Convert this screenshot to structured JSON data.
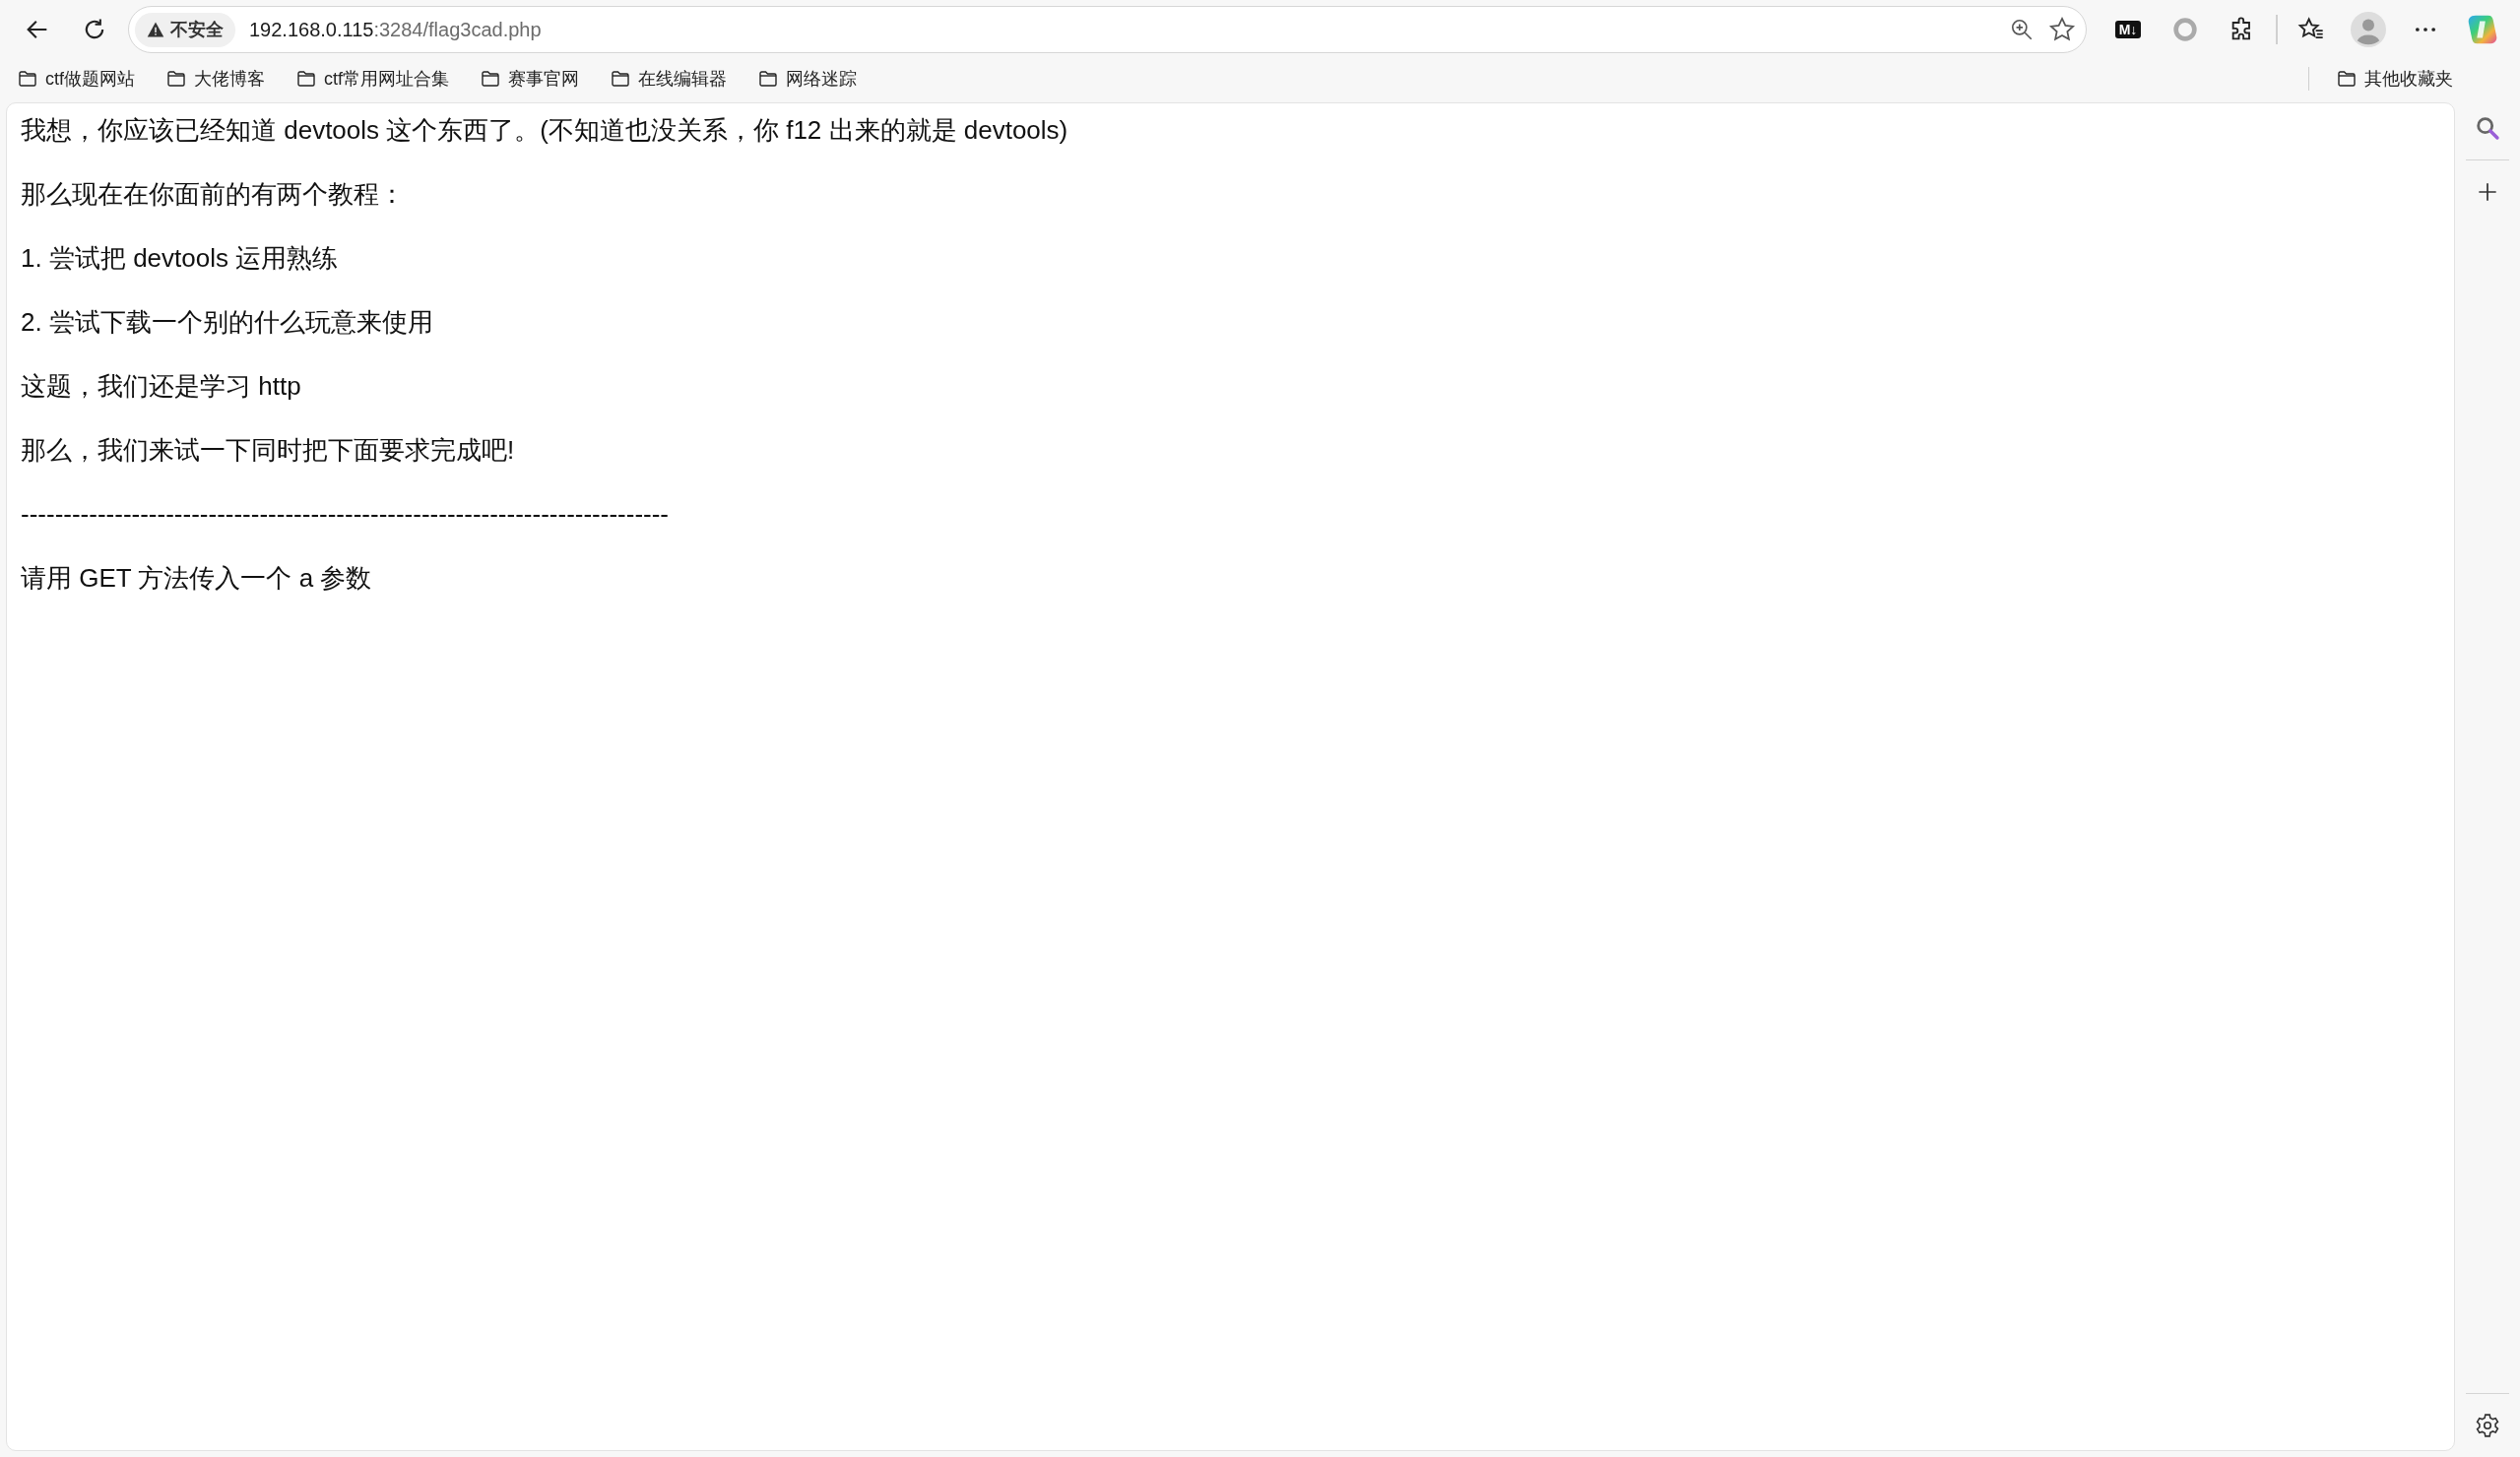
{
  "toolbar": {
    "security_label": "不安全",
    "url_host": "192.168.0.115",
    "url_path": ":3284/flag3cad.php",
    "extension_label": "M↓"
  },
  "bookmarks": [
    {
      "label": "ctf做题网站"
    },
    {
      "label": "大佬博客"
    },
    {
      "label": "ctf常用网址合集"
    },
    {
      "label": "赛事官网"
    },
    {
      "label": "在线编辑器"
    },
    {
      "label": "网络迷踪"
    }
  ],
  "other_bookmarks": {
    "label": "其他收藏夹"
  },
  "page": {
    "paragraphs": [
      "我想，你应该已经知道 devtools 这个东西了。(不知道也没关系，你 f12 出来的就是 devtools)",
      "那么现在在你面前的有两个教程：",
      "1. 尝试把 devtools 运用熟练",
      "2. 尝试下载一个别的什么玩意来使用",
      "这题，我们还是学习 http",
      "那么，我们来试一下同时把下面要求完成吧!",
      "----------------------------------------------------------------------------",
      "请用 GET 方法传入一个 a 参数"
    ]
  }
}
